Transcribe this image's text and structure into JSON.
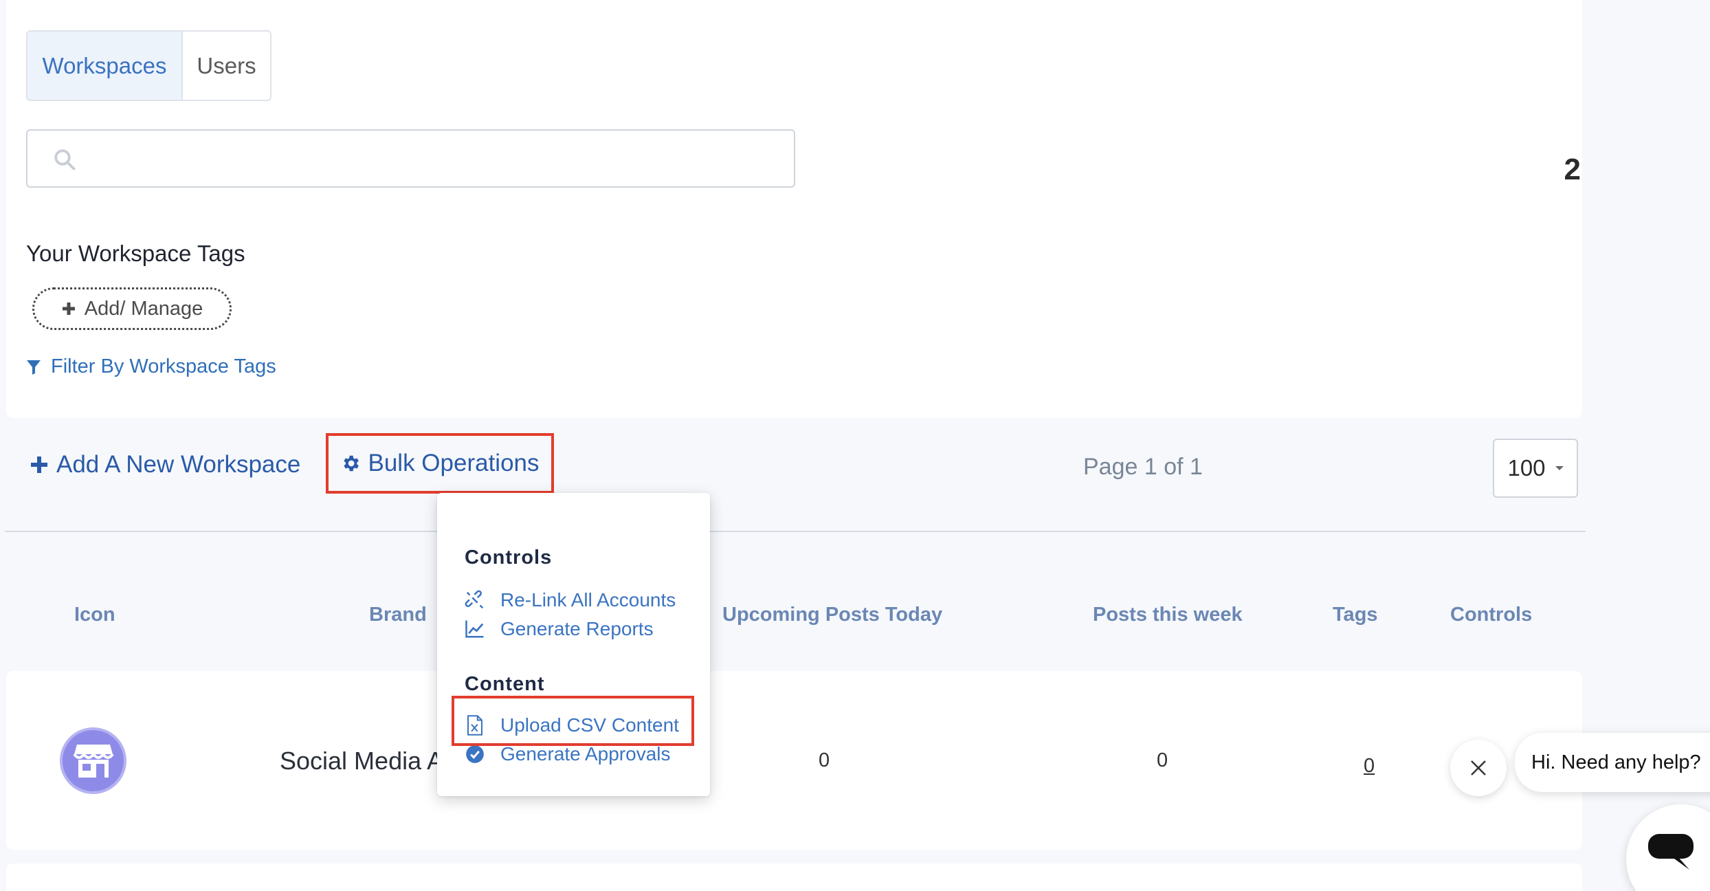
{
  "tabs": [
    {
      "label": "Workspaces",
      "active": true
    },
    {
      "label": "Users",
      "active": false
    }
  ],
  "search": {
    "placeholder": "",
    "value": ""
  },
  "workspace_count": "2",
  "tags_section": {
    "heading": "Your Workspace Tags",
    "add_manage_label": "Add/ Manage",
    "filter_label": "Filter By Workspace Tags"
  },
  "toolbar": {
    "add_workspace_label": "Add A New Workspace",
    "bulk_operations_label": "Bulk Operations",
    "page_info": "Page 1 of 1",
    "page_size": "100"
  },
  "table": {
    "headers": [
      "Icon",
      "Brand",
      "Upcoming Posts Today",
      "Posts this week",
      "Tags",
      "Controls"
    ],
    "rows": [
      {
        "brand": "Social Media A",
        "upcoming_today": "0",
        "posts_week": "0",
        "tags": "0"
      }
    ]
  },
  "bulk_menu": {
    "sections": [
      {
        "title": "Controls",
        "items": [
          {
            "label": "Re-Link All Accounts",
            "icon": "unlink-icon"
          },
          {
            "label": "Generate Reports",
            "icon": "chart-line-icon"
          }
        ]
      },
      {
        "title": "Content",
        "items": [
          {
            "label": "Upload CSV Content",
            "icon": "csv-file-icon"
          },
          {
            "label": "Generate Approvals",
            "icon": "check-circle-icon"
          }
        ]
      }
    ]
  },
  "chat": {
    "greeting": "Hi. Need any help?"
  },
  "colors": {
    "accent_blue": "#3a74c2",
    "dark_blue": "#2a5aa8",
    "highlight_red": "#e23d2e",
    "avatar_purple": "#8e8be8"
  }
}
